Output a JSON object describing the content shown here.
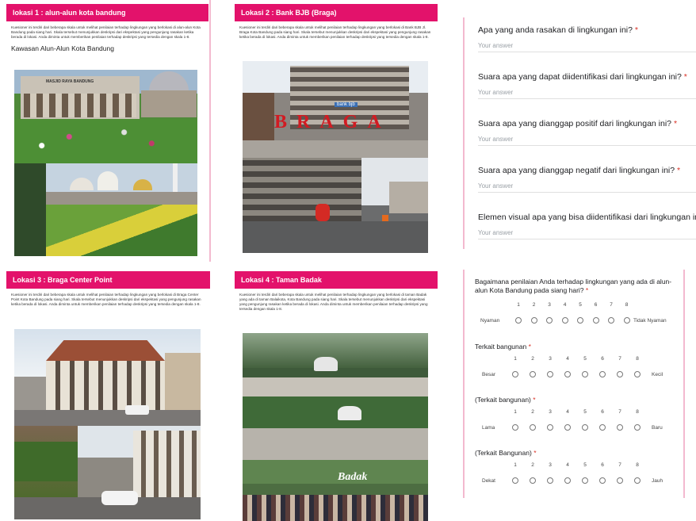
{
  "panels": [
    {
      "title": "lokasi 1 : alun-alun kota bandung",
      "description": "Kuesioner ini terdiri dari beberapa skala untuk melihat penilaian terhadap lingkungan yang berlokasi di alun-alun Kota Bandung pada siang hari. Skala tersebut menunjukkan deskripsi dari ekspektasi yang pengunjung rasakan ketika berada di lokasi. Anda diminta untuk memberikan penilaian terhadap deskripsi yang tersedia dengan skala 1-8.",
      "subtitle": "Kawasan Alun-Alun Kota Bandung",
      "sign_text": "MASJID RAYA BANDUNG"
    },
    {
      "title": "Lokasi 2 : Bank BJB (Braga)",
      "description": "Kuesioner ini terdiri dari beberapa skala untuk melihat penilaian terhadap lingkungan yang berlokasi di Bank BJB Jl. Braga Kota Bandung pada siang hari. Skala tersebut menunjukkan deskripsi dari ekspektasi yang pengunjung rasakan ketika berada di lokasi. Anda diminta untuk memberikan penilaian terhadap deskripsi yang tersedia dengan skala 1-8.",
      "sign_text": "bank bjb",
      "letters": "BRAGA"
    },
    {
      "title": "Lokasi 3 : Braga Center Point",
      "description": "Kuesioner ini terdiri dari beberapa skala untuk melihat penilaian terhadap lingkungan yang berlokasi di Braga Center Point Kota Bandung pada siang hari. Skala tersebut menunjukkan deskripsi dari ekspektasi yang pengunjung rasakan ketika berada di lokasi. Anda diminta untuk memberikan penilaian terhadap deskripsi yang tersedia dengan skala 1-8."
    },
    {
      "title": "Lokasi 4 : Taman Badak",
      "description": "Kuesioner ini terdiri dari beberapa skala untuk melihat penilaian terhadap lingkungan yang berlokasi di taman Badak yang ada di taman Balaikota, Kota Bandung pada siang hari. Skala tersebut menunjukkan deskripsi dari ekspektasi yang pengunjung rasakan ketika berada di lokasi. Anda diminta untuk memberikan penilaian terhadap deskripsi yang tersedia dengan skala 1-8.",
      "sign_text": "Badak"
    }
  ],
  "questions": [
    {
      "text": "Apa yang anda rasakan di lingkungan ini?",
      "required": "*",
      "placeholder": "Your answer"
    },
    {
      "text": "Suara apa yang dapat diidentifikasi dari lingkungan ini?",
      "required": "*",
      "placeholder": "Your answer"
    },
    {
      "text": "Suara apa yang dianggap positif dari lingkungan ini?",
      "required": "*",
      "placeholder": "Your answer"
    },
    {
      "text": "Suara apa yang dianggap negatif dari lingkungan ini?",
      "required": "*",
      "placeholder": "Your answer"
    },
    {
      "text": "Elemen visual apa yang bisa diidentifikasi dari lingkungan ini?",
      "required": "*",
      "placeholder": "Your answer"
    }
  ],
  "scales": [
    {
      "title": "Bagaimana penilaian Anda terhadap lingkungan yang ada di alun-alun Kota Bandung pada siang hari?",
      "required": "*",
      "left": "Nyaman",
      "right": "Tidak Nyaman",
      "numbers": [
        "1",
        "2",
        "3",
        "4",
        "5",
        "6",
        "7",
        "8"
      ]
    },
    {
      "title": "Terkait bangunan",
      "required": "*",
      "left": "Besar",
      "right": "Kecil",
      "numbers": [
        "1",
        "2",
        "3",
        "4",
        "5",
        "6",
        "7",
        "8"
      ]
    },
    {
      "title": "(Terkait bangunan)",
      "required": "*",
      "left": "Lama",
      "right": "Baru",
      "numbers": [
        "1",
        "2",
        "3",
        "4",
        "5",
        "6",
        "7",
        "8"
      ]
    },
    {
      "title": "(Terkait Bangunan)",
      "required": "*",
      "left": "Dekat",
      "right": "Jauh",
      "numbers": [
        "1",
        "2",
        "3",
        "4",
        "5",
        "6",
        "7",
        "8"
      ]
    }
  ],
  "colors": {
    "header": "#e3126b",
    "required": "#d93025",
    "placeholder": "#9aa0a6"
  }
}
